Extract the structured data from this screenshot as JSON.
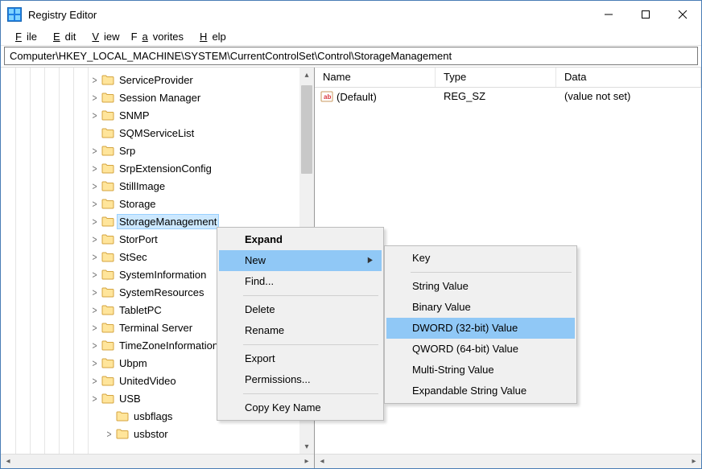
{
  "window": {
    "title": "Registry Editor"
  },
  "menu": {
    "file": "File",
    "edit": "Edit",
    "view": "View",
    "favorites": "Favorites",
    "help": "Help"
  },
  "address": "Computer\\HKEY_LOCAL_MACHINE\\SYSTEM\\CurrentControlSet\\Control\\StorageManagement",
  "tree": {
    "items": [
      {
        "label": "ServiceProvider",
        "expandable": true
      },
      {
        "label": "Session Manager",
        "expandable": true
      },
      {
        "label": "SNMP",
        "expandable": true
      },
      {
        "label": "SQMServiceList",
        "expandable": false
      },
      {
        "label": "Srp",
        "expandable": true
      },
      {
        "label": "SrpExtensionConfig",
        "expandable": true
      },
      {
        "label": "StillImage",
        "expandable": true
      },
      {
        "label": "Storage",
        "expandable": true
      },
      {
        "label": "StorageManagement",
        "expandable": true,
        "selected": true
      },
      {
        "label": "StorPort",
        "expandable": true
      },
      {
        "label": "StSec",
        "expandable": true
      },
      {
        "label": "SystemInformation",
        "expandable": true
      },
      {
        "label": "SystemResources",
        "expandable": true
      },
      {
        "label": "TabletPC",
        "expandable": true
      },
      {
        "label": "Terminal Server",
        "expandable": true
      },
      {
        "label": "TimeZoneInformation",
        "expandable": true
      },
      {
        "label": "Ubpm",
        "expandable": true
      },
      {
        "label": "UnitedVideo",
        "expandable": true
      },
      {
        "label": "USB",
        "expandable": true
      },
      {
        "label": "usbflags",
        "expandable": false,
        "indent": 1
      },
      {
        "label": "usbstor",
        "expandable": true,
        "indent": 1
      }
    ]
  },
  "list": {
    "headers": {
      "name": "Name",
      "type": "Type",
      "data": "Data"
    },
    "rows": [
      {
        "name": "(Default)",
        "type": "REG_SZ",
        "data": "(value not set)"
      }
    ]
  },
  "context_main": {
    "expand": "Expand",
    "new": "New",
    "find": "Find...",
    "delete": "Delete",
    "rename": "Rename",
    "export": "Export",
    "permissions": "Permissions...",
    "copy_key_name": "Copy Key Name"
  },
  "context_new": {
    "key": "Key",
    "string": "String Value",
    "binary": "Binary Value",
    "dword": "DWORD (32-bit) Value",
    "qword": "QWORD (64-bit) Value",
    "multi": "Multi-String Value",
    "expandable": "Expandable String Value"
  }
}
